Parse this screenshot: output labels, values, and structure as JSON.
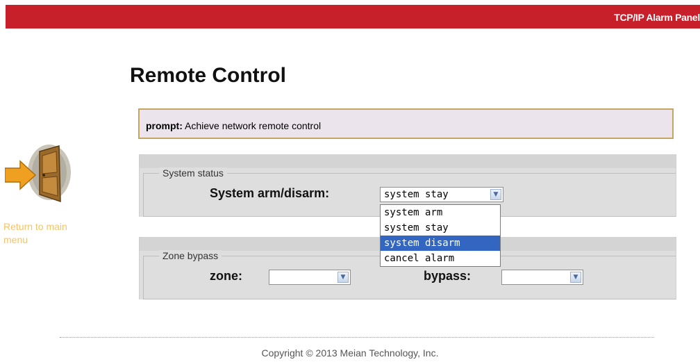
{
  "header": {
    "product_name": "TCP/IP Alarm Panel",
    "bar_color": "#c8202a"
  },
  "page": {
    "title": "Remote Control"
  },
  "prompt": {
    "label": "prompt",
    "separator": ":",
    "text": "Achieve network remote control"
  },
  "nav": {
    "return_label": "Return to main menu",
    "icon": "door-exit-icon"
  },
  "system_status": {
    "legend": "System status",
    "arm_label": "System arm/disarm:",
    "selected_value": "system stay",
    "options": [
      "system arm",
      "system stay",
      "system disarm",
      "cancel alarm"
    ],
    "highlighted_option": "system disarm"
  },
  "zone_bypass": {
    "legend": "Zone bypass",
    "zone_label": "zone:",
    "zone_value": "",
    "bypass_label": "bypass:",
    "bypass_value": ""
  },
  "footer": {
    "copyright": "Copyright © 2013 Meian Technology, Inc."
  }
}
